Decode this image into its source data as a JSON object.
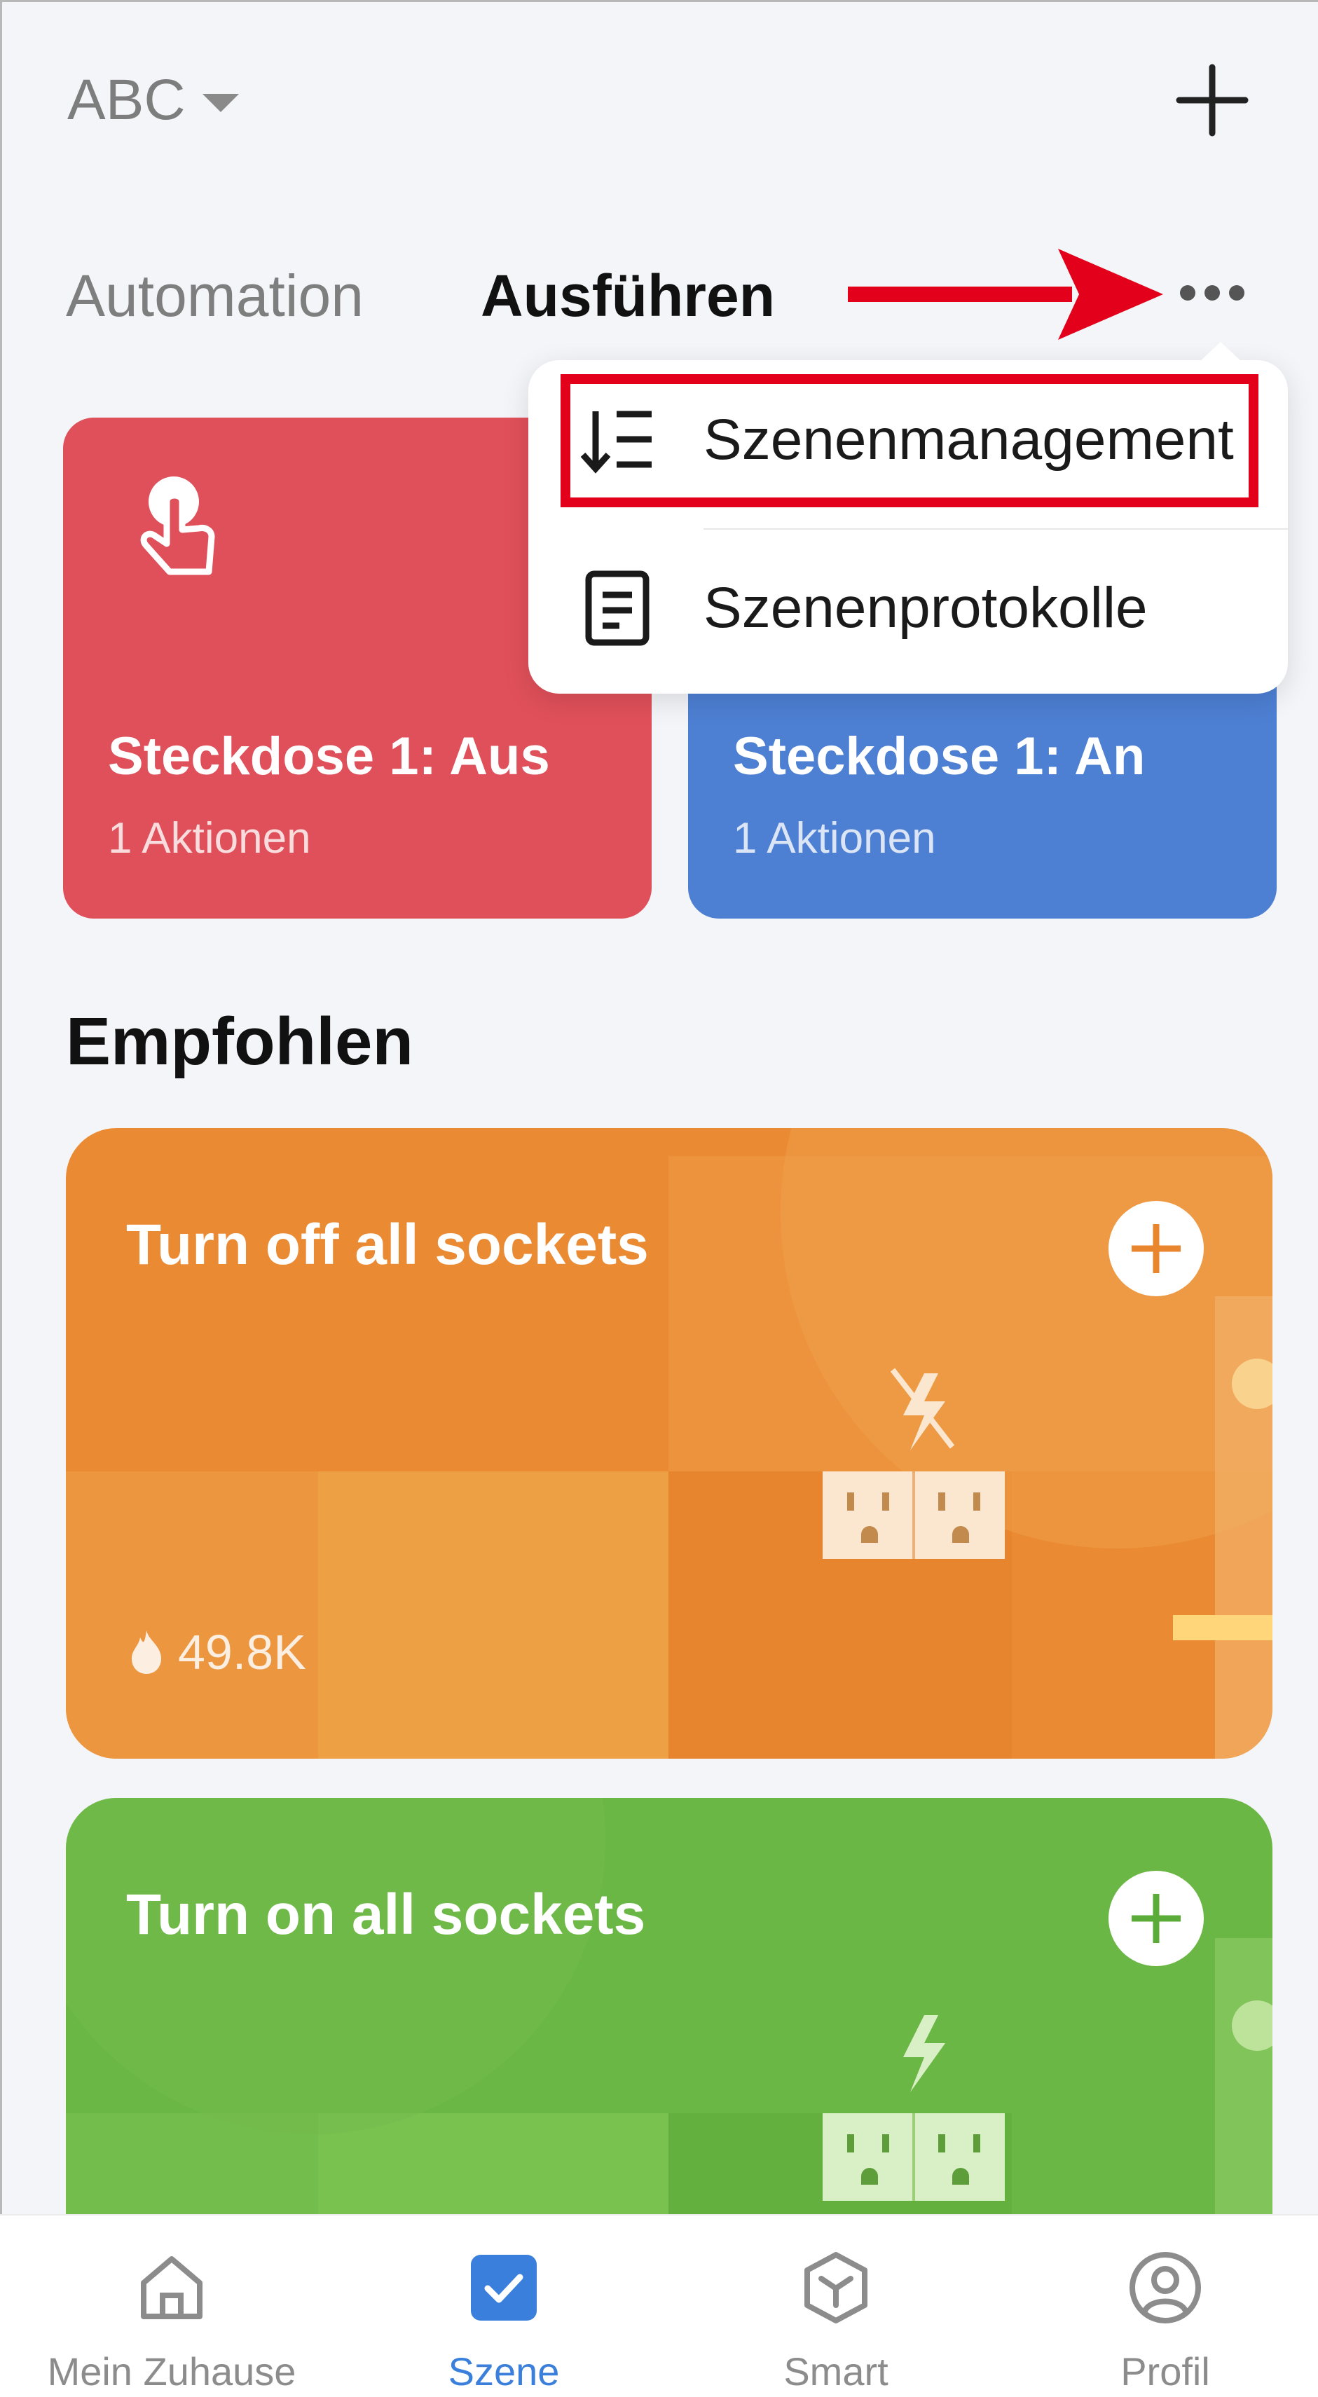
{
  "header": {
    "home_name": "ABC"
  },
  "tabs": [
    {
      "label": "Automation"
    },
    {
      "label": "Ausführen"
    }
  ],
  "menu": {
    "items": [
      {
        "label": "Szenenmanagement"
      },
      {
        "label": "Szenenprotokolle"
      }
    ]
  },
  "scenes": [
    {
      "title": "Steckdose 1: Aus",
      "subtitle": "1 Aktionen",
      "color": "#e0505a"
    },
    {
      "title": "Steckdose 1: An",
      "subtitle": "1 Aktionen",
      "color": "#4d7fd3"
    }
  ],
  "recommended": {
    "section_title": "Empfohlen",
    "cards": [
      {
        "title": "Turn off all sockets",
        "count": "49.8K",
        "color": "#ea8a33"
      },
      {
        "title": "Turn on all sockets",
        "color": "#6ab745"
      }
    ]
  },
  "bottom_nav": {
    "items": [
      {
        "label": "Mein Zuhause",
        "icon": "home-icon"
      },
      {
        "label": "Szene",
        "icon": "scene-check-icon",
        "active": true
      },
      {
        "label": "Smart",
        "icon": "smart-cube-icon"
      },
      {
        "label": "Profil",
        "icon": "profile-icon"
      }
    ],
    "active_color": "#3a7fdc"
  },
  "annotation": {
    "color": "#e2001a"
  }
}
